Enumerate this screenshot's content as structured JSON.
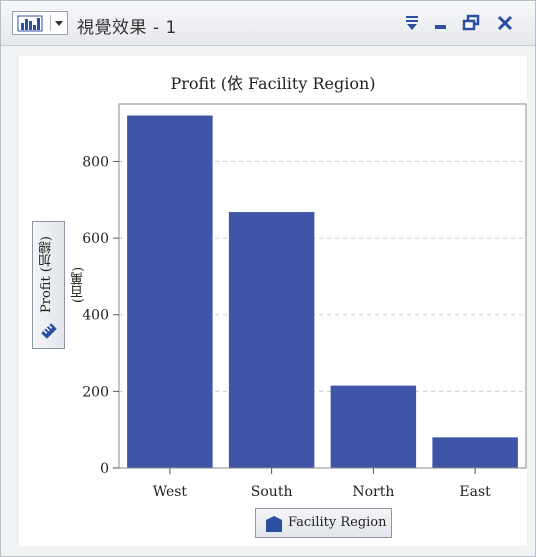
{
  "window": {
    "title": "視覺效果 - 1",
    "menu_icon": "collapse-menu-icon",
    "minimize_icon": "minimize-icon",
    "restore_icon": "restore-icon",
    "close_icon": "close-icon",
    "close_symbol": "✕",
    "minimize_symbol": "▬",
    "restore_symbol": "⧉",
    "menu_symbol": "≡"
  },
  "toolbar": {
    "chart_type_icon": "bar-chart-icon",
    "dropdown_icon": "dropdown-arrow-icon"
  },
  "chart_data": {
    "type": "bar",
    "title": "Profit (依 Facility Region)",
    "xlabel": "Facility Region",
    "ylabel": "Profit (加總)",
    "yunit": "(百萬)",
    "categories": [
      "West",
      "South",
      "North",
      "East"
    ],
    "values": [
      920,
      668,
      215,
      80
    ],
    "ylim": [
      0,
      950
    ],
    "yticks": [
      0,
      200,
      400,
      600,
      800
    ],
    "grid": true,
    "bar_color": "#3e55a8"
  },
  "colors": {
    "bar": "#3e55a8",
    "accent": "#2d4fa0",
    "grid": "#cfcfcf"
  }
}
